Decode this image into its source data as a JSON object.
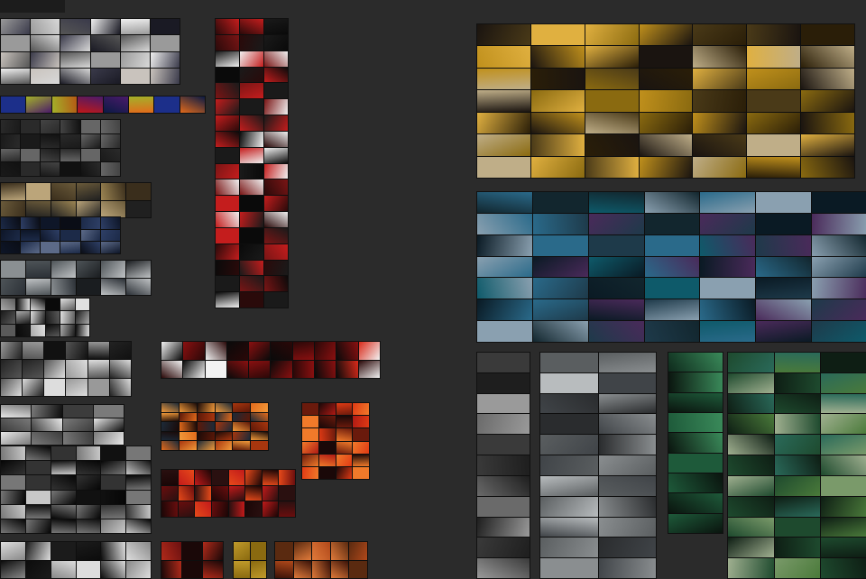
{
  "canvas": {
    "background": "#2b2b2b",
    "toolbar_label": ""
  },
  "clusters": [
    {
      "name": "cluster-white-faces",
      "cols": 6,
      "rows": 4,
      "palette": [
        "#d8d8d8",
        "#9a9a9a",
        "#f0f0f0",
        "#3a3a4a",
        "#1a1a24",
        "#c9c3bd",
        "#555"
      ]
    },
    {
      "name": "cluster-neon-strip",
      "cols": 8,
      "rows": 1,
      "palette": [
        "#0a1a44",
        "#1c2f8a",
        "#b55a14",
        "#e26a1b",
        "#4a1a6a",
        "#a3b12a",
        "#c01818"
      ]
    },
    {
      "name": "cluster-dark-mono-1",
      "cols": 6,
      "rows": 4,
      "palette": [
        "#1a1a1a",
        "#2a2a2a",
        "#444",
        "#111",
        "#666"
      ]
    },
    {
      "name": "cluster-gold-warm-1",
      "cols": 6,
      "rows": 2,
      "palette": [
        "#6a5a3a",
        "#3a2e1c",
        "#9c8553",
        "#202020",
        "#bba57a"
      ]
    },
    {
      "name": "cluster-blue-night",
      "cols": 6,
      "rows": 3,
      "palette": [
        "#0e1628",
        "#1c2a48",
        "#2e3f66",
        "#0a0d16",
        "#5c6a88"
      ]
    },
    {
      "name": "cluster-foggy-gray",
      "cols": 6,
      "rows": 2,
      "palette": [
        "#4e5458",
        "#2b3036",
        "#8a8f92",
        "#1a1d20",
        "#bfc2c4"
      ]
    },
    {
      "name": "cluster-mono-figures",
      "cols": 6,
      "rows": 3,
      "palette": [
        "#1a1a1a",
        "#5a5a5a",
        "#aaaaaa",
        "#0a0a0a",
        "#e0e0e0"
      ]
    },
    {
      "name": "cluster-mono-action",
      "cols": 6,
      "rows": 3,
      "palette": [
        "#222",
        "#555",
        "#999",
        "#111",
        "#ddd"
      ]
    },
    {
      "name": "cluster-mono-vehicles",
      "cols": 4,
      "rows": 3,
      "palette": [
        "#0d0d0d",
        "#3c3c3c",
        "#e8e8e8",
        "#7a7a7a"
      ]
    },
    {
      "name": "cluster-mono-large",
      "cols": 6,
      "rows": 6,
      "palette": [
        "#111",
        "#333",
        "#777",
        "#c8c8c8",
        "#060606"
      ]
    },
    {
      "name": "cluster-mono-bottom",
      "cols": 6,
      "rows": 2,
      "palette": [
        "#1b1b1b",
        "#888",
        "#ddd",
        "#0c0c0c"
      ]
    },
    {
      "name": "cluster-red-poster-column",
      "cols": 3,
      "rows": 18,
      "palette": [
        "#0a0a0a",
        "#c41d1d",
        "#f0f0f0",
        "#2a0a0a",
        "#7a1515",
        "#1a1a1a"
      ]
    },
    {
      "name": "cluster-red-black-strip",
      "cols": 10,
      "rows": 2,
      "palette": [
        "#0a0a0a",
        "#8a1010",
        "#d92a1a",
        "#f2f2f2",
        "#2a0808"
      ]
    },
    {
      "name": "cluster-orange-fire",
      "cols": 6,
      "rows": 5,
      "palette": [
        "#a8360e",
        "#e26a1b",
        "#1a0a08",
        "#5c1808",
        "#f29a3a",
        "#1c2a38"
      ]
    },
    {
      "name": "cluster-red-fire-2",
      "cols": 4,
      "rows": 6,
      "palette": [
        "#b01a14",
        "#e03a14",
        "#1a0808",
        "#6a1a0c",
        "#f07a2a"
      ]
    },
    {
      "name": "cluster-red-strip-2",
      "cols": 8,
      "rows": 3,
      "palette": [
        "#c11a1a",
        "#6a0e0e",
        "#1a0606",
        "#e84a1a",
        "#2a1010"
      ]
    },
    {
      "name": "cluster-red-bottom-1",
      "cols": 3,
      "rows": 2,
      "palette": [
        "#6a1010",
        "#1a0808",
        "#b02a1a"
      ]
    },
    {
      "name": "cluster-gold-bottom",
      "cols": 2,
      "rows": 2,
      "palette": [
        "#8a6a10",
        "#2a2008",
        "#c09a2a"
      ]
    },
    {
      "name": "cluster-orange-bottom",
      "cols": 5,
      "rows": 2,
      "palette": [
        "#b0481a",
        "#3a1208",
        "#e07a3a",
        "#5a2a10"
      ]
    },
    {
      "name": "cluster-golden-sunset",
      "cols": 7,
      "rows": 7,
      "palette": [
        "#8a6a10",
        "#c0901c",
        "#e0b040",
        "#2a1e08",
        "#4a3a18",
        "#bfae88",
        "#1a1410"
      ]
    },
    {
      "name": "cluster-teal-blue",
      "cols": 7,
      "rows": 7,
      "palette": [
        "#1e3a4a",
        "#0e5a6a",
        "#2a6a8a",
        "#0a1a24",
        "#4a2a5a",
        "#8aa0b0",
        "#12262e"
      ]
    },
    {
      "name": "cluster-desat-gray-col",
      "cols": 1,
      "rows": 11,
      "palette": [
        "#3a3a3a",
        "#6a6a6a",
        "#1e1e1e",
        "#9a9a9a"
      ]
    },
    {
      "name": "cluster-misty-gray",
      "cols": 2,
      "rows": 11,
      "palette": [
        "#5a5e60",
        "#8a8e90",
        "#2a2c2e",
        "#b8bcbe",
        "#404448"
      ]
    },
    {
      "name": "cluster-green-dark",
      "cols": 1,
      "rows": 9,
      "palette": [
        "#0e2a1c",
        "#1e5a3a",
        "#0a140e",
        "#3a8a5a"
      ]
    },
    {
      "name": "cluster-green-teal-large",
      "cols": 3,
      "rows": 11,
      "palette": [
        "#1e4a2e",
        "#4a7a3a",
        "#0e1e14",
        "#2a6a5a",
        "#7a9a6a",
        "#a0b090"
      ]
    }
  ]
}
